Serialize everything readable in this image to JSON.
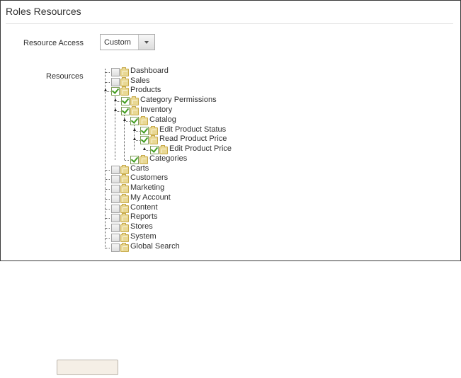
{
  "panel": {
    "title": "Roles Resources",
    "resource_access_label": "Resource Access",
    "resources_label": "Resources"
  },
  "resource_access": {
    "selected": "Custom"
  },
  "tree": [
    {
      "label": "Dashboard",
      "checked": false
    },
    {
      "label": "Sales",
      "checked": false
    },
    {
      "label": "Products",
      "checked": true
    },
    {
      "label": "Category Permissions",
      "checked": true
    },
    {
      "label": "Inventory",
      "checked": true
    },
    {
      "label": "Catalog",
      "checked": true
    },
    {
      "label": "Edit Product Status",
      "checked": true
    },
    {
      "label": "Read Product Price",
      "checked": true
    },
    {
      "label": "Edit Product Price",
      "checked": true
    },
    {
      "label": "Categories",
      "checked": true
    },
    {
      "label": "Carts",
      "checked": false
    },
    {
      "label": "Customers",
      "checked": false
    },
    {
      "label": "Marketing",
      "checked": false
    },
    {
      "label": "My Account",
      "checked": false
    },
    {
      "label": "Content",
      "checked": false
    },
    {
      "label": "Reports",
      "checked": false
    },
    {
      "label": "Stores",
      "checked": false
    },
    {
      "label": "System",
      "checked": false
    },
    {
      "label": "Global Search",
      "checked": false
    }
  ],
  "colors": {
    "check": "#3f9c1e",
    "folder": "#e9d893",
    "button_bg": "#f5efe6"
  }
}
